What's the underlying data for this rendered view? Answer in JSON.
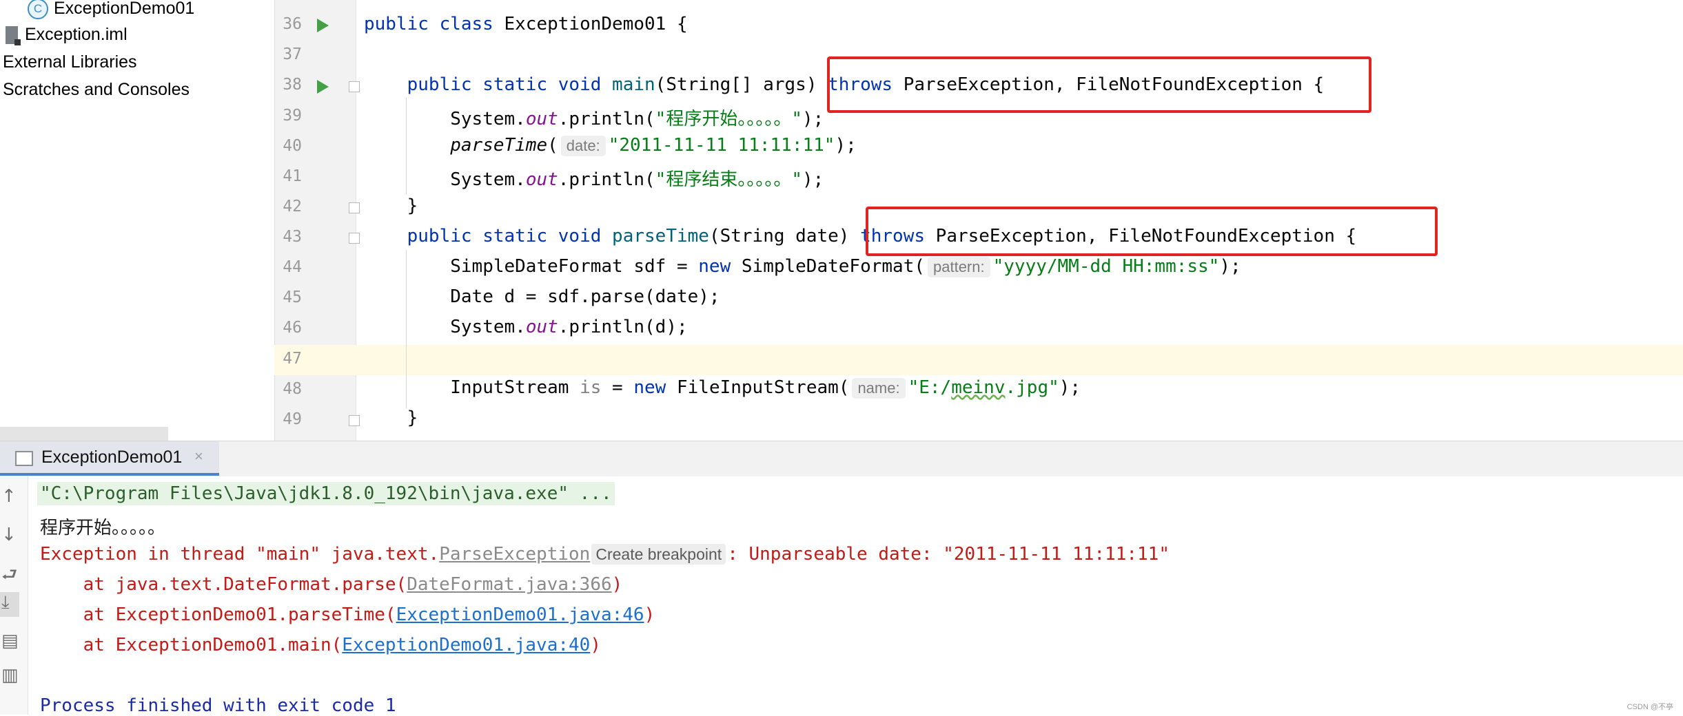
{
  "project_tree": {
    "items": [
      {
        "label": "ExceptionDemo01",
        "icon": "class-icon",
        "icon_glyph": "C"
      },
      {
        "label": "Exception.iml",
        "icon": "module-file-icon"
      },
      {
        "label": "External Libraries"
      },
      {
        "label": "Scratches and Consoles"
      }
    ]
  },
  "editor": {
    "line_numbers": [
      "36",
      "37",
      "38",
      "39",
      "40",
      "41",
      "42",
      "43",
      "44",
      "45",
      "46",
      "47",
      "48",
      "49"
    ],
    "lines": {
      "l36": {
        "kw1": "public class",
        "rest": " ExceptionDemo01 {"
      },
      "l38": {
        "kw": "public static void",
        "name": "main",
        "params": "(String[] args) ",
        "throws": "throws",
        "exc": " ParseException, FileNotFoundException {"
      },
      "l39": {
        "a": "System.",
        "fld": "out",
        "b": ".println(",
        "str": "\"程序开始。。。。。\"",
        "end": ");"
      },
      "l40": {
        "call": "parseTime",
        "open": "(",
        "hint": "date:",
        "str": "\"2011-11-11 11:11:11\"",
        "end": ");"
      },
      "l41": {
        "a": "System.",
        "fld": "out",
        "b": ".println(",
        "str": "\"程序结束。。。。。\"",
        "end": ");"
      },
      "l42": {
        "text": "}"
      },
      "l43": {
        "kw": "public static void",
        "name": "parseTime",
        "params": "(String date) ",
        "throws": "throws",
        "exc": " ParseException, FileNotFoundException {"
      },
      "l44": {
        "a": "SimpleDateFormat sdf = ",
        "kw": "new",
        "b": " SimpleDateFormat(",
        "hint": "pattern:",
        "str": "\"yyyy/MM-dd HH:mm:ss\"",
        "end": ");"
      },
      "l45": {
        "text": "Date d = sdf.parse(date);"
      },
      "l46": {
        "a": "System.",
        "fld": "out",
        "b": ".println(d);"
      },
      "l48": {
        "a": "InputStream ",
        "unused": "is",
        "b": " = ",
        "kw": "new",
        "c": " FileInputStream(",
        "hint": "name:",
        "str_a": "\"E:/",
        "str_typo": "meinv",
        "str_b": ".jpg\"",
        "end": ");"
      },
      "l49": {
        "text": "}"
      }
    }
  },
  "run_panel": {
    "tab_label": "ExceptionDemo01",
    "tab_close": "×",
    "toolbar_icons": [
      "up-arrow-icon",
      "down-arrow-icon",
      "soft-wrap-icon",
      "scroll-to-end-icon",
      "print-icon",
      "clear-icon"
    ],
    "console": {
      "command": "\"C:\\Program Files\\Java\\jdk1.8.0_192\\bin\\java.exe\" ...",
      "start_output": "程序开始。。。。。",
      "exception_prefix": "Exception in thread \"main\" java.text.",
      "exception_class": "ParseException",
      "breakpoint_hint": "Create breakpoint",
      "exception_suffix": ": Unparseable date: \"2011-11-11 11:11:11\"",
      "stack": [
        {
          "prefix": "    at java.text.DateFormat.parse(",
          "link": "DateFormat.java:366",
          "suffix": ")",
          "link_style": "gray"
        },
        {
          "prefix": "    at ExceptionDemo01.parseTime(",
          "link": "ExceptionDemo01.java:46",
          "suffix": ")",
          "link_style": "blue"
        },
        {
          "prefix": "    at ExceptionDemo01.main(",
          "link": "ExceptionDemo01.java:40",
          "suffix": ")",
          "link_style": "blue"
        }
      ],
      "process_finished": "Process finished with exit code 1"
    }
  },
  "watermark": "CSDN @不亭",
  "colors": {
    "keyword": "#0033b3",
    "string": "#067d17",
    "field": "#871094",
    "error": "#c41a16",
    "highlight_box": "#e02424",
    "link": "#1a6fd0"
  }
}
